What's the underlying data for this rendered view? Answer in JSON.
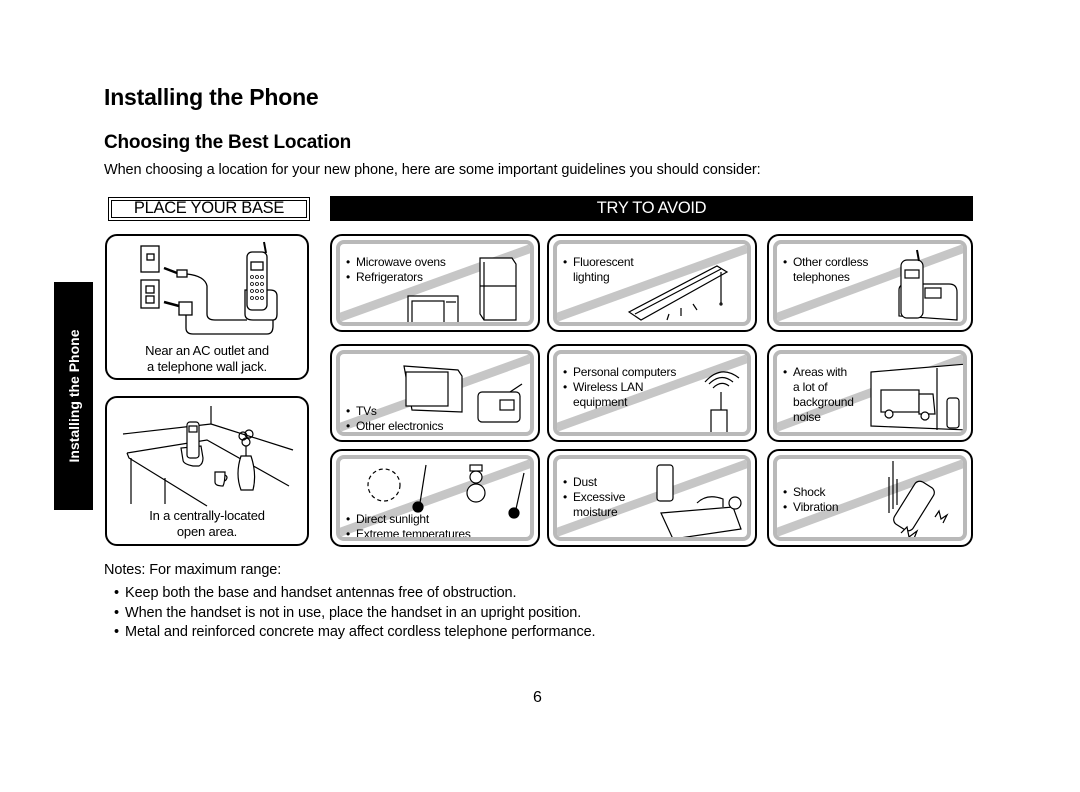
{
  "page": {
    "title": "Installing the Phone",
    "subtitle": "Choosing the Best Location",
    "intro": "When choosing a location for your new phone, here are some important guidelines you should consider:",
    "side_tab": "Installing the Phone",
    "page_number": "6"
  },
  "place_your_base": {
    "header": "PLACE YOUR BASE",
    "items": [
      {
        "caption_line1": "Near an AC outlet and",
        "caption_line2": "a telephone wall jack.",
        "icon": "phone-base-wall-jack-illustration"
      },
      {
        "caption_line1": "In a centrally-located",
        "caption_line2": "open area.",
        "icon": "phone-on-table-illustration"
      }
    ]
  },
  "try_to_avoid": {
    "header": "TRY TO AVOID",
    "items": [
      {
        "lines": [
          "Microwave ovens",
          "Refrigerators"
        ],
        "icon": "microwave-refrigerator-illustration"
      },
      {
        "lines": [
          "Fluorescent",
          "lighting"
        ],
        "icon": "fluorescent-light-illustration"
      },
      {
        "lines": [
          "Other cordless",
          "telephones"
        ],
        "icon": "cordless-phone-illustration"
      },
      {
        "lines": [
          "TVs",
          "Other electronics"
        ],
        "icon": "tv-radio-illustration"
      },
      {
        "lines": [
          "Personal computers",
          "Wireless LAN",
          "equipment"
        ],
        "icon": "wireless-router-illustration"
      },
      {
        "lines": [
          "Areas with",
          "a lot of",
          "background",
          "noise"
        ],
        "icon": "truck-window-illustration"
      },
      {
        "lines": [
          "Direct sunlight",
          "Extreme temperatures"
        ],
        "icon": "sun-snowman-thermometer-illustration"
      },
      {
        "lines": [
          "Dust",
          "Excessive",
          "moisture"
        ],
        "icon": "phone-near-sink-illustration"
      },
      {
        "lines": [
          "Shock",
          "Vibration"
        ],
        "icon": "dropped-phone-illustration"
      }
    ]
  },
  "notes": {
    "title": "Notes: For maximum range:",
    "items": [
      "Keep both the base and handset antennas free of obstruction.",
      "When the handset is not in use, place the handset in an upright position.",
      "Metal and reinforced concrete may affect cordless telephone performance."
    ]
  }
}
